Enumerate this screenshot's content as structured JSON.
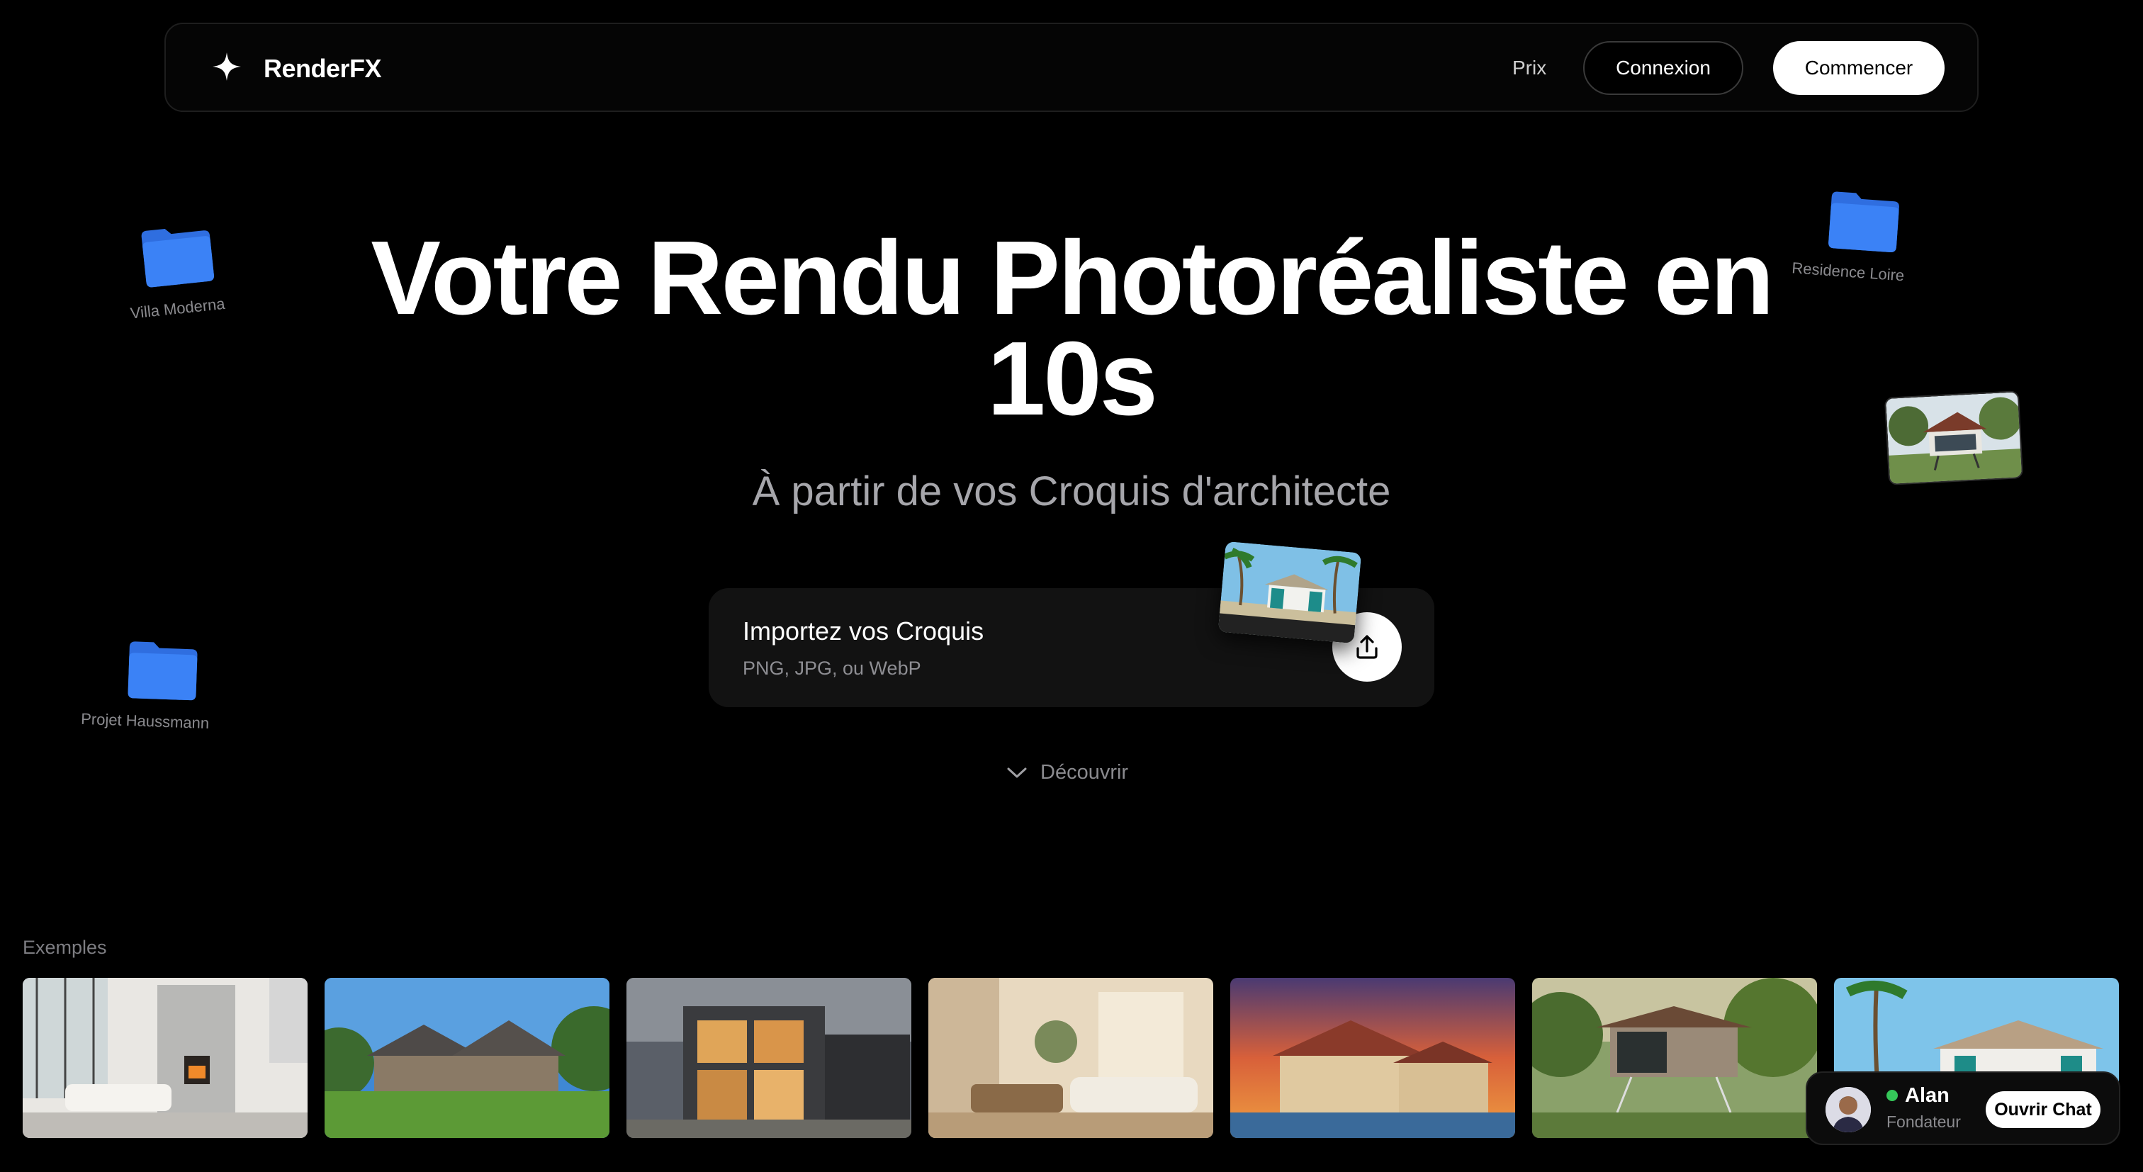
{
  "header": {
    "brand": "RenderFX",
    "logo_icon": "sparkle-icon",
    "nav_pricing": "Prix",
    "login_label": "Connexion",
    "cta_label": "Commencer"
  },
  "hero": {
    "title_line1": "Votre Rendu Photoréaliste en",
    "title_line2": "10s",
    "subtitle": "À partir de vos Croquis d'architecte"
  },
  "upload": {
    "title": "Importez vos Croquis",
    "formats": "PNG, JPG, ou WebP",
    "icon": "upload-icon"
  },
  "discover": {
    "label": "Découvrir",
    "icon": "chevron-down-icon"
  },
  "floating_folders": [
    {
      "label": "Villa Moderna"
    },
    {
      "label": "Residence Loire"
    },
    {
      "label": "Projet Haussmann"
    }
  ],
  "examples": {
    "label": "Exemples",
    "items": [
      {
        "alt": "living-room"
      },
      {
        "alt": "country-house"
      },
      {
        "alt": "modern-facade"
      },
      {
        "alt": "interior-lounge"
      },
      {
        "alt": "sunset-villa"
      },
      {
        "alt": "forest-house"
      },
      {
        "alt": "tropical-house"
      }
    ]
  },
  "chat": {
    "name": "Alan",
    "role": "Fondateur",
    "button_label": "Ouvrir Chat",
    "status_color": "#35c759"
  },
  "colors": {
    "background": "#000000",
    "accent_folder": "#3b7cf5",
    "muted_text": "#8a8a8e"
  }
}
